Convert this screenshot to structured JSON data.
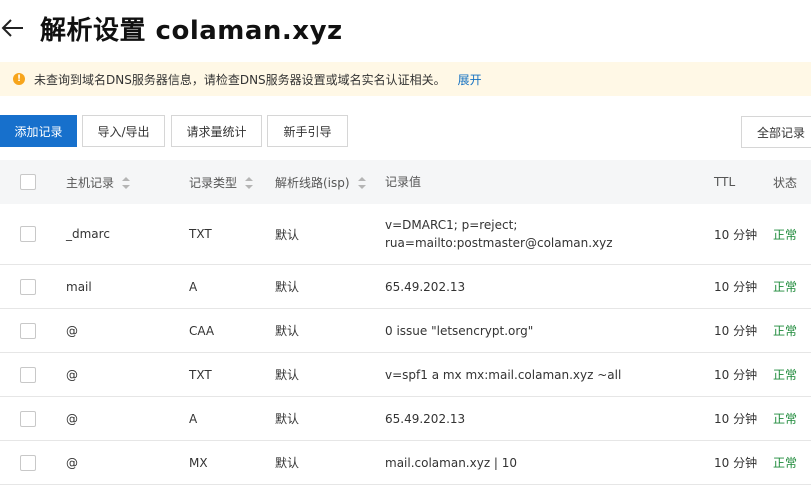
{
  "header": {
    "title": "解析设置 colaman.xyz"
  },
  "alert": {
    "message": "未查询到域名DNS服务器信息，请检查DNS服务器设置或域名实名认证相关。",
    "link": "展开"
  },
  "toolbar": {
    "add": "添加记录",
    "import_export": "导入/导出",
    "stats": "请求量统计",
    "guide": "新手引导",
    "all_records": "全部记录"
  },
  "table": {
    "headers": {
      "host": "主机记录",
      "type": "记录类型",
      "line": "解析线路(isp)",
      "value": "记录值",
      "ttl": "TTL",
      "status": "状态"
    },
    "rows": [
      {
        "host": "_dmarc",
        "type": "TXT",
        "line": "默认",
        "value": "v=DMARC1; p=reject; rua=mailto:postmaster@colaman.xyz",
        "ttl": "10 分钟",
        "status": "正常"
      },
      {
        "host": "mail",
        "type": "A",
        "line": "默认",
        "value": "65.49.202.13",
        "ttl": "10 分钟",
        "status": "正常"
      },
      {
        "host": "@",
        "type": "CAA",
        "line": "默认",
        "value": "0 issue \"letsencrypt.org\"",
        "ttl": "10 分钟",
        "status": "正常"
      },
      {
        "host": "@",
        "type": "TXT",
        "line": "默认",
        "value": "v=spf1 a mx mx:mail.colaman.xyz ~all",
        "ttl": "10 分钟",
        "status": "正常"
      },
      {
        "host": "@",
        "type": "A",
        "line": "默认",
        "value": "65.49.202.13",
        "ttl": "10 分钟",
        "status": "正常"
      },
      {
        "host": "@",
        "type": "MX",
        "line": "默认",
        "value": "mail.colaman.xyz | 10",
        "ttl": "10 分钟",
        "status": "正常"
      }
    ]
  },
  "colors": {
    "primary": "#1770cc",
    "status_ok": "#1f8b3b",
    "alert_bg": "#fff8e6",
    "alert_icon": "#f7a51c",
    "link": "#1672c2"
  }
}
